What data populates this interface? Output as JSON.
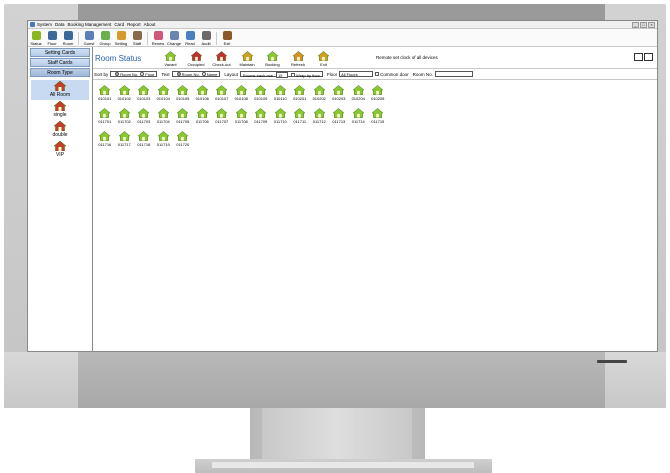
{
  "menu": [
    "System",
    "Data",
    "Booking Management",
    "Card",
    "Report",
    "About"
  ],
  "toolbar": [
    {
      "label": "Status",
      "icon": "lightbulb-icon",
      "color": "#8ab820"
    },
    {
      "label": "Floor",
      "icon": "building-icon",
      "color": "#3a6a9a"
    },
    {
      "label": "Room",
      "icon": "door-icon",
      "color": "#3a6a9a"
    },
    {
      "label": "Guest",
      "icon": "guest-icon",
      "color": "#5a80b8"
    },
    {
      "label": "Group",
      "icon": "group-icon",
      "color": "#6ab04c"
    },
    {
      "label": "Setting",
      "icon": "card-setting-icon",
      "color": "#d69a2c"
    },
    {
      "label": "Staff",
      "icon": "staff-icon",
      "color": "#8a6a4a"
    },
    {
      "label": "Renew",
      "icon": "renew-card-icon",
      "color": "#d0577a"
    },
    {
      "label": "Change",
      "icon": "change-card-icon",
      "color": "#6a86b0"
    },
    {
      "label": "Read",
      "icon": "read-card-icon",
      "color": "#4a80c0"
    },
    {
      "label": "Audit",
      "icon": "audit-icon",
      "color": "#6a6a6a"
    },
    {
      "label": "Exit",
      "icon": "exit-door-icon",
      "color": "#8a5a2a"
    }
  ],
  "sidebar": {
    "buttons": [
      "Setting Cards",
      "Staff Cards",
      "Room Type"
    ],
    "room_types": [
      "All Room",
      "single",
      "double",
      "VIP"
    ]
  },
  "header": {
    "title": "Room Status",
    "buttons": [
      {
        "label": "Vacant",
        "icon": "vacant-house-icon",
        "color": "#8ac830"
      },
      {
        "label": "Occupied",
        "icon": "occupied-icon",
        "color": "#c03030"
      },
      {
        "label": "Check-out",
        "icon": "check-out-icon",
        "color": "#c03030"
      },
      {
        "label": "Maintain",
        "icon": "maintain-icon",
        "color": "#d0a020"
      },
      {
        "label": "Booking",
        "icon": "booking-icon",
        "color": "#8ac830"
      },
      {
        "label": "Refresh",
        "icon": "refresh-icon",
        "color": "#d89020"
      },
      {
        "label": "Exit",
        "icon": "exit-icon",
        "color": "#d0a020"
      }
    ],
    "remote_text": "Remote set clock of all devices"
  },
  "options": {
    "sort_label": "Sort by",
    "sort_opt1": "Room No.",
    "sort_opt2": "Floor",
    "text_label": "Text",
    "text_opt1": "Room No.",
    "text_opt2": "Name",
    "layout_label": "Layout",
    "rows_label": "Rooms each row",
    "rows_value": "15",
    "wrap_label": "Wrap by floor",
    "floor_label": "Floor",
    "floor_value": "All Floors",
    "common_label": "Common door",
    "roomno_label": "Room No."
  },
  "rooms": [
    "010101",
    "010102",
    "010103",
    "010104",
    "010105",
    "010106",
    "010107",
    "010108",
    "010109",
    "010110",
    "010201",
    "010202",
    "010203",
    "010204",
    "010205",
    "011701",
    "011702",
    "011703",
    "011704",
    "011705",
    "011706",
    "011707",
    "011708",
    "011709",
    "011710",
    "011711",
    "011712",
    "011713",
    "011714",
    "011715",
    "011716",
    "011717",
    "011718",
    "011719",
    "011720"
  ]
}
